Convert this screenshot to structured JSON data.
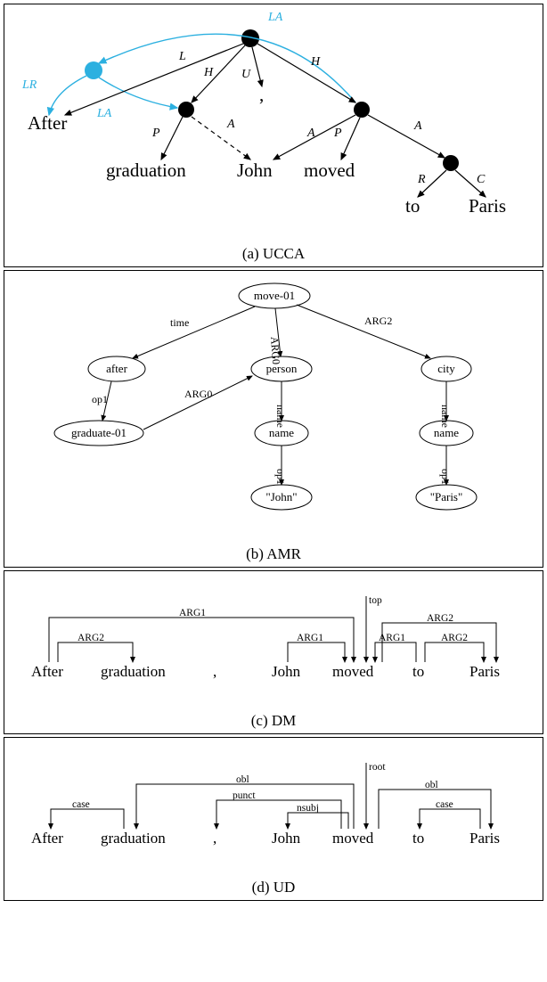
{
  "panels": [
    {
      "id": "ucca",
      "caption": "(a) UCCA"
    },
    {
      "id": "amr",
      "caption": "(b) AMR"
    },
    {
      "id": "dm",
      "caption": "(c) DM"
    },
    {
      "id": "ud",
      "caption": "(d) UD"
    }
  ],
  "ucca": {
    "words": [
      "After",
      "graduation",
      "John",
      ",",
      "moved",
      "to",
      "Paris"
    ],
    "edge_labels": {
      "LA_top": "LA",
      "LR": "LR",
      "L": "L",
      "H1": "H",
      "U": "U",
      "H2": "H",
      "LA2": "LA",
      "P1": "P",
      "A1": "A",
      "A2": "A",
      "P2": "P",
      "A3": "A",
      "R": "R",
      "C": "C"
    }
  },
  "amr": {
    "nodes": {
      "move": "move-01",
      "after": "after",
      "person": "person",
      "city": "city",
      "graduate": "graduate-01",
      "name1": "name",
      "name2": "name",
      "john": "\"John\"",
      "paris": "\"Paris\""
    },
    "edges": {
      "time": "time",
      "arg0": "ARG0",
      "arg2": "ARG2",
      "op1a": "op1",
      "arg0b": "ARG0",
      "name_a": "name",
      "name_b": "name",
      "op1b": "op1",
      "op1c": "op1"
    }
  },
  "dm": {
    "words": [
      "After",
      "graduation",
      ",",
      "John",
      "moved",
      "to",
      "Paris"
    ],
    "labels": {
      "top": "top",
      "arg1_long": "ARG1",
      "arg2_a": "ARG2",
      "arg1_b": "ARG1",
      "arg1_c": "ARG1",
      "arg2_b": "ARG2",
      "arg2_c": "ARG2"
    }
  },
  "ud": {
    "words": [
      "After",
      "graduation",
      ",",
      "John",
      "moved",
      "to",
      "Paris"
    ],
    "labels": {
      "root": "root",
      "obl1": "obl",
      "case1": "case",
      "punct": "punct",
      "nsubj": "nsubj",
      "obl2": "obl",
      "case2": "case"
    }
  }
}
